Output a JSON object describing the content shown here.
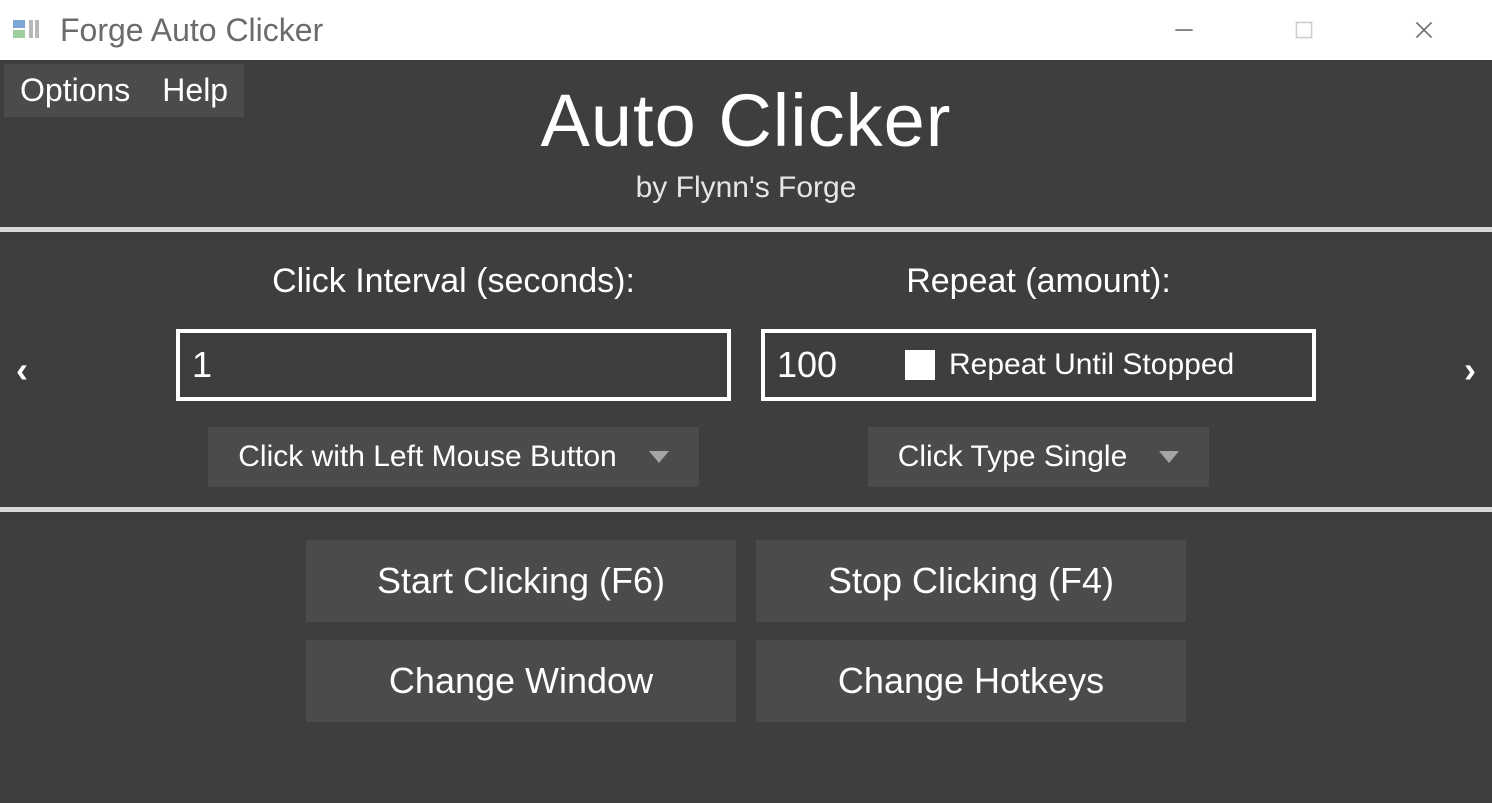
{
  "window": {
    "title": "Forge Auto Clicker"
  },
  "menubar": {
    "options": "Options",
    "help": "Help"
  },
  "header": {
    "title": "Auto Clicker",
    "subtitle": "by Flynn's Forge"
  },
  "settings": {
    "interval_label": "Click Interval (seconds):",
    "interval_value": "1",
    "repeat_label": "Repeat (amount):",
    "repeat_value": "100",
    "repeat_until_stopped_label": "Repeat Until Stopped",
    "mouse_button_dropdown": "Click with Left Mouse Button",
    "click_type_dropdown": "Click Type Single"
  },
  "carousel": {
    "prev": "‹",
    "next": "›"
  },
  "buttons": {
    "start": "Start Clicking (F6)",
    "stop": "Stop Clicking (F4)",
    "change_window": "Change Window",
    "change_hotkeys": "Change Hotkeys"
  }
}
